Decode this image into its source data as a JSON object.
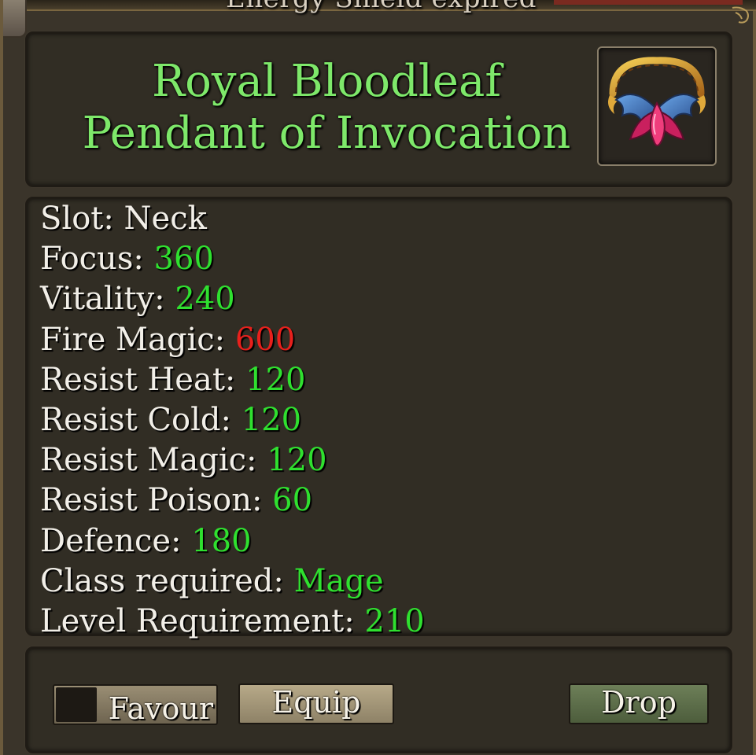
{
  "notification": "Energy Shield expired",
  "item": {
    "name_line1": "Royal Bloodleaf",
    "name_line2": "Pendant of Invocation",
    "icon": "winged-pendant-icon"
  },
  "stats": [
    {
      "label": "Slot:",
      "value": "Neck",
      "color": "white"
    },
    {
      "label": "Focus:",
      "value": "360",
      "color": "green"
    },
    {
      "label": "Vitality:",
      "value": "240",
      "color": "green"
    },
    {
      "label": "Fire Magic:",
      "value": "600",
      "color": "red"
    },
    {
      "label": "Resist Heat:",
      "value": "120",
      "color": "green"
    },
    {
      "label": "Resist Cold:",
      "value": "120",
      "color": "green"
    },
    {
      "label": "Resist Magic:",
      "value": "120",
      "color": "green"
    },
    {
      "label": "Resist Poison:",
      "value": "60",
      "color": "green"
    },
    {
      "label": "Defence:",
      "value": "180",
      "color": "green"
    },
    {
      "label": "Class required:",
      "value": "Mage",
      "color": "green"
    },
    {
      "label": "Level Requirement: ",
      "value": "210",
      "color": "green"
    }
  ],
  "actions": {
    "favour_label": "Favour",
    "favour_checked": false,
    "equip_label": "Equip",
    "drop_label": "Drop"
  },
  "colors": {
    "title_green": "#7ee86a",
    "value_green": "#2fe02f",
    "value_red": "#e8201c",
    "text_white": "#f2efe8"
  }
}
